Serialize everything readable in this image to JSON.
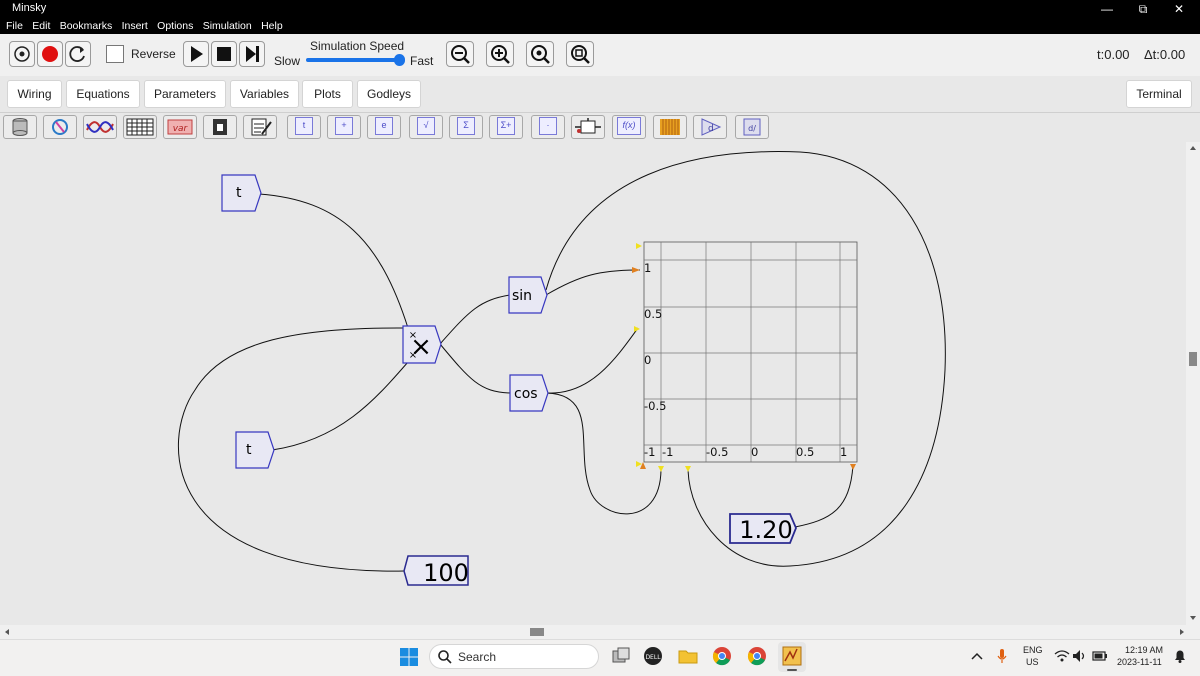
{
  "window": {
    "title": "Minsky",
    "minimize": "—",
    "restore": "⧉",
    "close": "✕"
  },
  "menu": [
    "File",
    "Edit",
    "Bookmarks",
    "Insert",
    "Options",
    "Simulation",
    "Help"
  ],
  "toolbar": {
    "reverse_label": "Reverse",
    "speed_title": "Simulation Speed",
    "slow_label": "Slow",
    "fast_label": "Fast",
    "speed_level": 1.0,
    "time": "t:0.00",
    "dt": "Δt:0.00"
  },
  "tabs": [
    "Wiring",
    "Equations",
    "Parameters",
    "Variables",
    "Plots",
    "Godleys"
  ],
  "terminal_label": "Terminal",
  "icon_tools": [
    {
      "name": "database-icon",
      "glyph": ""
    },
    {
      "name": "sync-icon",
      "glyph": ""
    },
    {
      "name": "plot-waves-icon",
      "glyph": ""
    },
    {
      "name": "grid-table-icon",
      "glyph": ""
    },
    {
      "name": "variable-icon",
      "glyph": "var"
    },
    {
      "name": "lock-icon",
      "glyph": ""
    },
    {
      "name": "notepad-icon",
      "glyph": ""
    },
    {
      "name": "time-op-icon",
      "glyph": "t"
    },
    {
      "name": "add-op-icon",
      "glyph": "+"
    },
    {
      "name": "euler-op-icon",
      "glyph": "e"
    },
    {
      "name": "sqrt-op-icon",
      "glyph": "√"
    },
    {
      "name": "sum-op-icon",
      "glyph": "Σ"
    },
    {
      "name": "running-sum-op-icon",
      "glyph": "Σ+"
    },
    {
      "name": "dot-op-icon",
      "glyph": "·"
    },
    {
      "name": "switch-icon",
      "glyph": ""
    },
    {
      "name": "function-icon",
      "glyph": "f(x)"
    },
    {
      "name": "sheet-icon",
      "glyph": ""
    },
    {
      "name": "integral-icon",
      "glyph": "d"
    },
    {
      "name": "derivative-icon",
      "glyph": ""
    }
  ],
  "canvas": {
    "ops": {
      "t_top": "t",
      "t_bottom": "t",
      "multiply": "×",
      "sin": "sin",
      "cos": "cos"
    },
    "constants": {
      "c100": "100",
      "c120": "1.20"
    },
    "plot": {
      "y_ticks": [
        "1",
        "0.5",
        "0",
        "-0.5",
        "-1"
      ],
      "x_ticks": [
        "-1",
        "-0.5",
        "0",
        "0.5",
        "1"
      ]
    }
  },
  "taskbar": {
    "search_placeholder": "Search",
    "lang_top": "ENG",
    "lang_bottom": "US",
    "time": "12:19 AM",
    "date": "2023-11-11"
  }
}
